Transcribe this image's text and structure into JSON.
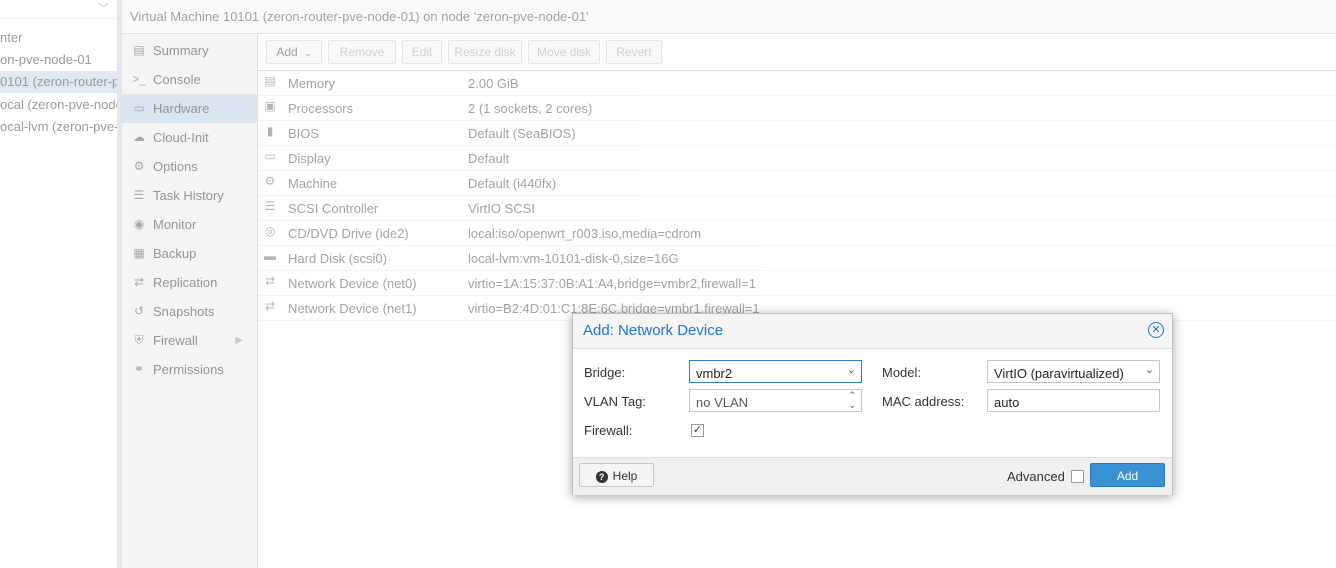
{
  "header": {
    "title": "Virtual Machine 10101 (zeron-router-pve-node-01) on node 'zeron-pve-node-01'"
  },
  "tree": {
    "items": [
      {
        "label": "nter"
      },
      {
        "label": "on-pve-node-01"
      },
      {
        "label": "0101 (zeron-router-p",
        "selected": true
      },
      {
        "label": "ocal (zeron-pve-node"
      },
      {
        "label": "ocal-lvm (zeron-pve-"
      }
    ]
  },
  "menu": {
    "items": [
      {
        "label": "Summary",
        "icon": "book-icon"
      },
      {
        "label": "Console",
        "icon": "terminal-icon"
      },
      {
        "label": "Hardware",
        "icon": "monitor-icon",
        "selected": true
      },
      {
        "label": "Cloud-Init",
        "icon": "cloud-icon"
      },
      {
        "label": "Options",
        "icon": "gear-icon"
      },
      {
        "label": "Task History",
        "icon": "list-icon"
      },
      {
        "label": "Monitor",
        "icon": "eye-icon"
      },
      {
        "label": "Backup",
        "icon": "floppy-icon"
      },
      {
        "label": "Replication",
        "icon": "retweet-icon"
      },
      {
        "label": "Snapshots",
        "icon": "history-icon"
      },
      {
        "label": "Firewall",
        "icon": "shield-icon",
        "has_submenu": true
      },
      {
        "label": "Permissions",
        "icon": "unlock-icon"
      }
    ]
  },
  "toolbar": {
    "add": "Add",
    "remove": "Remove",
    "edit": "Edit",
    "resize_disk": "Resize disk",
    "move_disk": "Move disk",
    "revert": "Revert"
  },
  "hardware": {
    "rows": [
      {
        "name": "Memory",
        "value": "2.00 GiB",
        "icon": "memory-icon"
      },
      {
        "name": "Processors",
        "value": "2 (1 sockets, 2 cores)",
        "icon": "cpu-icon"
      },
      {
        "name": "BIOS",
        "value": "Default (SeaBIOS)",
        "icon": "microchip-icon"
      },
      {
        "name": "Display",
        "value": "Default",
        "icon": "desktop-icon"
      },
      {
        "name": "Machine",
        "value": "Default (i440fx)",
        "icon": "cogs-icon"
      },
      {
        "name": "SCSI Controller",
        "value": "VirtIO SCSI",
        "icon": "database-icon"
      },
      {
        "name": "CD/DVD Drive (ide2)",
        "value": "local:iso/openwrt_r003.iso,media=cdrom",
        "icon": "cdrom-icon"
      },
      {
        "name": "Hard Disk (scsi0)",
        "value": "local-lvm:vm-10101-disk-0,size=16G",
        "icon": "hdd-icon"
      },
      {
        "name": "Network Device (net0)",
        "value": "virtio=1A:15:37:0B:A1:A4,bridge=vmbr2,firewall=1",
        "icon": "exchange-icon"
      },
      {
        "name": "Network Device (net1)",
        "value": "virtio=B2:4D:01:C1:8E:6C,bridge=vmbr1,firewall=1",
        "icon": "exchange-icon"
      }
    ]
  },
  "dialog": {
    "title": "Add: Network Device",
    "bridge_label": "Bridge:",
    "bridge_value": "vmbr2",
    "vlan_label": "VLAN Tag:",
    "vlan_placeholder": "no VLAN",
    "firewall_label": "Firewall:",
    "firewall_checked": true,
    "model_label": "Model:",
    "model_value": "VirtIO (paravirtualized)",
    "mac_label": "MAC address:",
    "mac_value": "auto",
    "help_label": "Help",
    "advanced_label": "Advanced",
    "advanced_checked": false,
    "add_label": "Add"
  },
  "colors": {
    "accent": "#3892d4",
    "selected": "#c6d9ec",
    "title_blue": "#1976d2"
  }
}
